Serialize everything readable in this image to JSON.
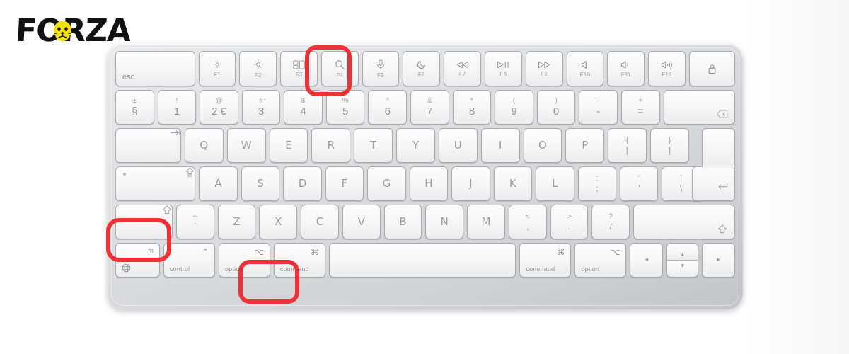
{
  "brand": {
    "name": "FORZA",
    "logo_icon": "lion-head-icon",
    "logo_accent_color": "#f5e10a",
    "logo_text_color": "#111111"
  },
  "highlight": {
    "color": "#ec3237",
    "keys": [
      "F4",
      "left-shift",
      "command"
    ]
  },
  "keyboard": {
    "type": "apple-magic-keyboard",
    "layout": "ISO",
    "function_row": [
      {
        "label": "esc",
        "icon": "",
        "fnum": "",
        "kind": "esc"
      },
      {
        "label": "",
        "icon": "☀",
        "fnum": "F1",
        "kind": "fn",
        "icon_name": "brightness-down-icon"
      },
      {
        "label": "",
        "icon": "☀",
        "fnum": "F2",
        "kind": "fn",
        "icon_name": "brightness-up-icon"
      },
      {
        "label": "",
        "icon": "",
        "fnum": "F3",
        "kind": "fn",
        "icon_name": "mission-control-icon"
      },
      {
        "label": "",
        "icon": "",
        "fnum": "F4",
        "kind": "fn",
        "icon_name": "search-spotlight-icon"
      },
      {
        "label": "",
        "icon": "",
        "fnum": "F5",
        "kind": "fn",
        "icon_name": "microphone-dictation-icon"
      },
      {
        "label": "",
        "icon": "",
        "fnum": "F6",
        "kind": "fn",
        "icon_name": "moon-do-not-disturb-icon"
      },
      {
        "label": "",
        "icon": "",
        "fnum": "F7",
        "kind": "fn",
        "icon_name": "rewind-icon"
      },
      {
        "label": "",
        "icon": "",
        "fnum": "F8",
        "kind": "fn",
        "icon_name": "play-pause-icon"
      },
      {
        "label": "",
        "icon": "",
        "fnum": "F9",
        "kind": "fn",
        "icon_name": "fast-forward-icon"
      },
      {
        "label": "",
        "icon": "",
        "fnum": "F10",
        "kind": "fn",
        "icon_name": "mute-icon"
      },
      {
        "label": "",
        "icon": "",
        "fnum": "F11",
        "kind": "fn",
        "icon_name": "volume-down-icon"
      },
      {
        "label": "",
        "icon": "",
        "fnum": "F12",
        "kind": "fn",
        "icon_name": "volume-up-icon"
      },
      {
        "label": "",
        "icon": "",
        "fnum": "",
        "kind": "lock",
        "icon_name": "lock-touchid-icon"
      }
    ],
    "number_row": [
      {
        "up": "±",
        "low": "§"
      },
      {
        "up": "!",
        "low": "1"
      },
      {
        "up": "@",
        "low": "2 €"
      },
      {
        "up": "#",
        "low": "3"
      },
      {
        "up": "$",
        "low": "4"
      },
      {
        "up": "%",
        "low": "5"
      },
      {
        "up": "^",
        "low": "6"
      },
      {
        "up": "&",
        "low": "7"
      },
      {
        "up": "*",
        "low": "8"
      },
      {
        "up": "(",
        "low": "9"
      },
      {
        "up": ")",
        "low": "0"
      },
      {
        "up": "–",
        "low": "-"
      },
      {
        "up": "+",
        "low": "="
      }
    ],
    "delete_key": {
      "icon_name": "delete-backspace-icon"
    },
    "qwerty_row": {
      "tab": {
        "icon_name": "tab-icon"
      },
      "keys": [
        "Q",
        "W",
        "E",
        "R",
        "T",
        "Y",
        "U",
        "I",
        "O",
        "P"
      ],
      "bracket_left": {
        "up": "{",
        "low": "["
      },
      "bracket_right": {
        "up": "}",
        "low": "]"
      }
    },
    "return_key": {
      "icon_name": "return-enter-icon"
    },
    "home_row": {
      "caps_lock": {
        "icon_name": "caps-lock-icon",
        "indicator": "caps-lock-led"
      },
      "keys": [
        "A",
        "S",
        "D",
        "F",
        "G",
        "H",
        "J",
        "K",
        "L"
      ],
      "semicolon": {
        "up": ":",
        "low": ";"
      },
      "quote": {
        "up": "\"",
        "low": "'"
      },
      "backslash": {
        "up": "|",
        "low": "\\"
      }
    },
    "bottom_letter_row": {
      "left_shift": {
        "icon_name": "shift-arrow-icon"
      },
      "tilde": {
        "up": "~",
        "low": "`"
      },
      "keys": [
        "Z",
        "X",
        "C",
        "V",
        "B",
        "N",
        "M"
      ],
      "comma": {
        "up": "<",
        "low": ","
      },
      "period": {
        "up": ">",
        "low": "."
      },
      "slash": {
        "up": "?",
        "low": "/"
      },
      "right_shift": {
        "icon_name": "shift-arrow-icon"
      }
    },
    "modifier_row": {
      "fn": {
        "name": "fn",
        "icon_name": "globe-icon"
      },
      "control_left": {
        "sym": "⌃",
        "name": "control",
        "icon_name": "control-caret-icon"
      },
      "option_left": {
        "sym": "⌥",
        "name": "option",
        "icon_name": "option-alt-icon"
      },
      "command_left": {
        "sym": "⌘",
        "name": "command",
        "icon_name": "command-icon"
      },
      "space": {
        "name": "",
        "icon_name": "space-bar"
      },
      "command_right": {
        "sym": "⌘",
        "name": "command",
        "icon_name": "command-icon"
      },
      "option_right": {
        "sym": "⌥",
        "name": "option",
        "icon_name": "option-alt-icon"
      },
      "arrow_left": {
        "icon_name": "arrow-left-icon",
        "glyph": "◂"
      },
      "arrow_up": {
        "icon_name": "arrow-up-icon",
        "glyph": "▴"
      },
      "arrow_down": {
        "icon_name": "arrow-down-icon",
        "glyph": "▾"
      },
      "arrow_right": {
        "icon_name": "arrow-right-icon",
        "glyph": "▸"
      }
    }
  }
}
